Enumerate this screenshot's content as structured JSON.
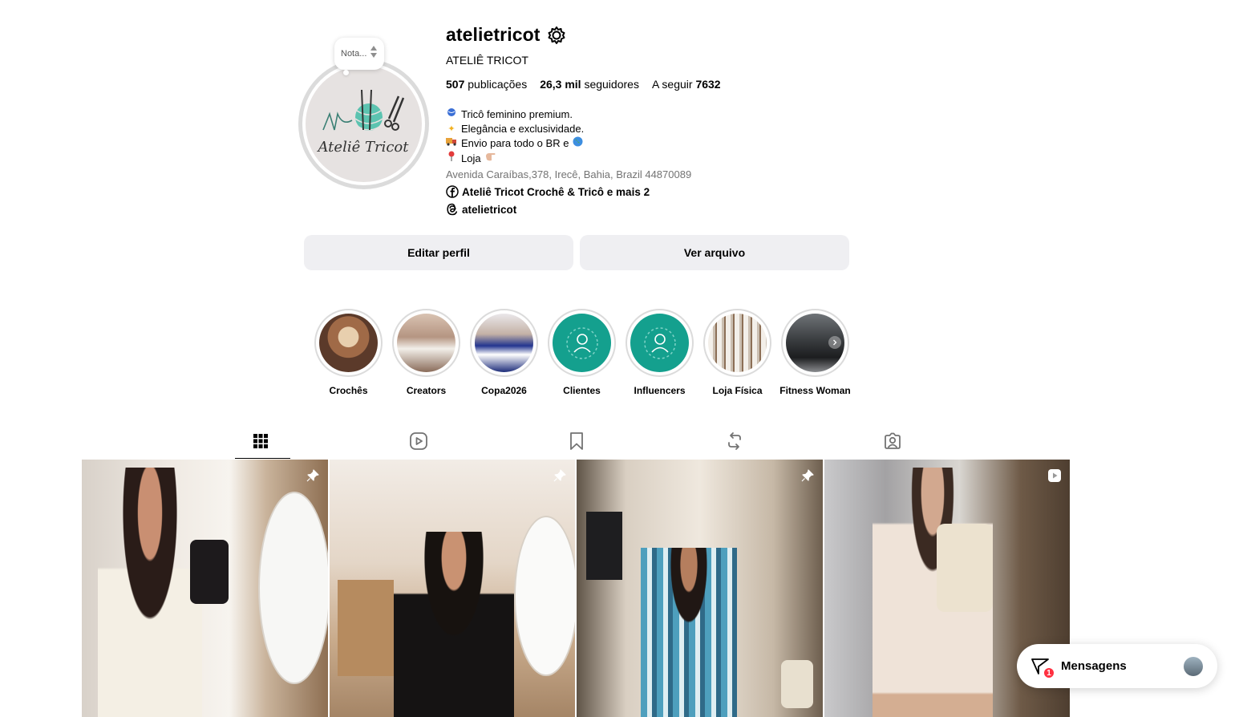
{
  "profile": {
    "note_label": "Nota...",
    "avatar_logo_text": "Ateliê Tricot",
    "username": "atelietricot",
    "full_name": "ATELIÊ TRICOT",
    "stats": {
      "posts_count": "507",
      "posts_label": "publicações",
      "followers_count": "26,3 mil",
      "followers_label": "seguidores",
      "following_label": "A seguir",
      "following_count": "7632"
    },
    "bio": [
      {
        "emoji": "yarn-ball",
        "text": "Tricô feminino premium."
      },
      {
        "emoji": "sparkles",
        "text": "Elegância e exclusividade."
      },
      {
        "emoji": "delivery-truck",
        "text": "Envio para todo o BR e"
      },
      {
        "emoji": "round-pushpin",
        "text": "Loja"
      }
    ],
    "address": "Avenida Caraíbas,378, Irecê, Bahia, Brazil 44870089",
    "facebook_link": "Ateliê Tricot Crochê & Tricô e mais 2",
    "threads_link": "atelietricot"
  },
  "actions": {
    "edit_profile": "Editar perfil",
    "view_archive": "Ver arquivo"
  },
  "highlights": [
    {
      "label": "Crochês"
    },
    {
      "label": "Creators"
    },
    {
      "label": "Copa2026"
    },
    {
      "label": "Clientes"
    },
    {
      "label": "Influencers"
    },
    {
      "label": "Loja Física"
    },
    {
      "label": "Fitness Woman"
    }
  ],
  "tabs": [
    {
      "name": "posts",
      "icon": "grid-icon",
      "active": true
    },
    {
      "name": "reels",
      "icon": "reels-icon",
      "active": false
    },
    {
      "name": "saved",
      "icon": "bookmark-icon",
      "active": false
    },
    {
      "name": "reposts",
      "icon": "repost-icon",
      "active": false
    },
    {
      "name": "tagged",
      "icon": "tagged-icon",
      "active": false
    }
  ],
  "posts": [
    {
      "badge": "pin-icon"
    },
    {
      "badge": "pin-icon"
    },
    {
      "badge": "pin-icon"
    },
    {
      "badge": "reel-icon"
    }
  ],
  "messages": {
    "label": "Mensagens",
    "unread_count": "1"
  },
  "colors": {
    "button_bg": "#efeff2",
    "highlight_teal": "#14a08e",
    "badge_red": "#ff3040",
    "secondary_text": "#737373"
  }
}
